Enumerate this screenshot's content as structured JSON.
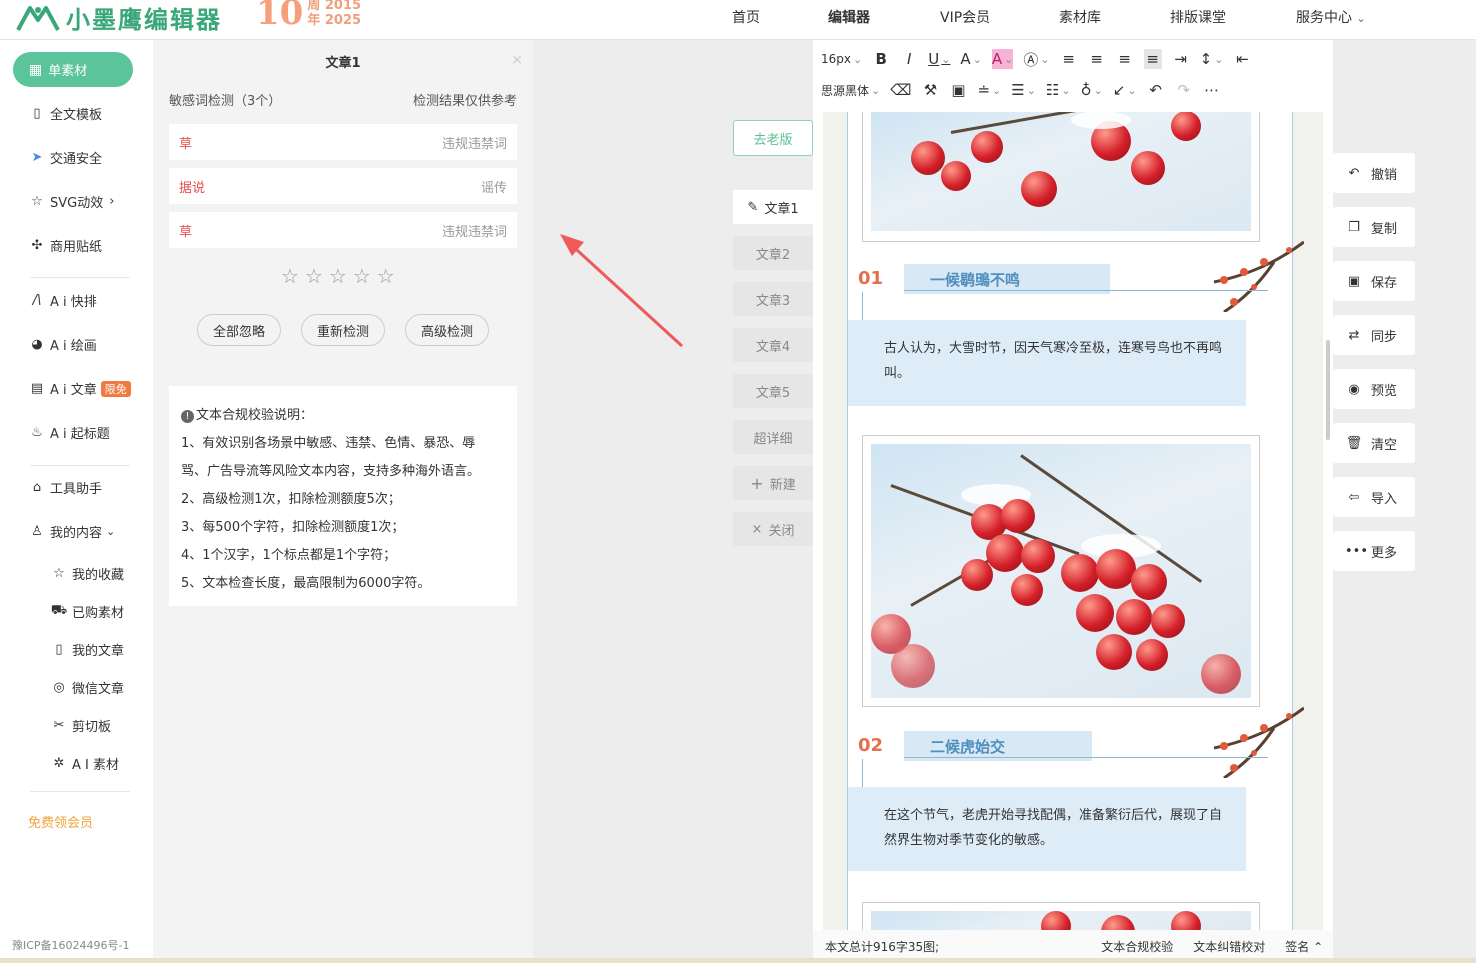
{
  "brand": {
    "name": "小墨鹰编辑器",
    "anniv_num": "10",
    "anniv_top": "周 2015",
    "anniv_bottom": "年 2025"
  },
  "nav": [
    "首页",
    "编辑器",
    "VIP会员",
    "素材库",
    "排版课堂",
    "服务中心"
  ],
  "sidebar": {
    "active": "单素材",
    "items": [
      {
        "label": "全文模板",
        "icon": "template-icon"
      },
      {
        "label": "交通安全",
        "icon": "traffic-icon"
      },
      {
        "label": "SVG动效",
        "icon": "star-icon",
        "arrow": "›"
      },
      {
        "label": "商用贴纸",
        "icon": "puzzle-icon"
      },
      {
        "label": "A i 快排",
        "icon": "ai-icon"
      },
      {
        "label": "A i 绘画",
        "icon": "palette-icon"
      },
      {
        "label": "A i 文章",
        "icon": "doc-icon",
        "badge": "限免"
      },
      {
        "label": "A i 起标题",
        "icon": "fire-icon"
      },
      {
        "label": "工具助手",
        "icon": "tool-icon"
      },
      {
        "label": "我的内容",
        "icon": "user-icon",
        "arrow": "⌄"
      }
    ],
    "sub": [
      {
        "label": "我的收藏",
        "icon": "star-icon"
      },
      {
        "label": "已购素材",
        "icon": "cart-icon"
      },
      {
        "label": "我的文章",
        "icon": "article-icon"
      },
      {
        "label": "微信文章",
        "icon": "wechat-icon"
      },
      {
        "label": "剪切板",
        "icon": "scissors-icon"
      },
      {
        "label": "A I 素材",
        "icon": "sparkle-icon"
      }
    ],
    "promo": "免费领会员",
    "icp": "豫ICP备16024496号-1"
  },
  "panel": {
    "title": "文章1",
    "close": "×",
    "detect_title": "敏感词检测（3个）",
    "detect_note": "检测结果仅供参考",
    "rows": [
      {
        "word": "草",
        "type": "违规违禁词"
      },
      {
        "word": "据说",
        "type": "谣传"
      },
      {
        "word": "草",
        "type": "违规违禁词"
      }
    ],
    "buttons": [
      "全部忽略",
      "重新检测",
      "高级检测"
    ],
    "note_title": "文本合规校验说明：",
    "note_lines": [
      "1、有效识别各场景中敏感、违禁、色情、暴恐、辱",
      "骂、广告导流等风险文本内容，支持多种海外语言。",
      "2、高级检测1次，扣除检测额度5次；",
      "3、每500个字符，扣除检测额度1次；",
      "4、1个汉字，1个标点都是1个字符；",
      "5、文本检查长度，最高限制为6000字符。"
    ]
  },
  "tabs": {
    "old": "去老版",
    "items": [
      "文章1",
      "文章2",
      "文章3",
      "文章4",
      "文章5",
      "超详细"
    ],
    "new": "新建",
    "close": "关闭"
  },
  "toolbar": {
    "font_size": "16px",
    "font_family": "思源黑体"
  },
  "content": {
    "sec1_num": "01",
    "sec1_title": "一候鹖鴠不鸣",
    "sec1_text": "古人认为，大雪时节，因天气寒冷至极，连寒号鸟也不再鸣叫。",
    "sec2_num": "02",
    "sec2_title": "二候虎始交",
    "sec2_text": "在这个节气，老虎开始寻找配偶，准备繁衍后代，展现了自然界生物对季节变化的敏感。"
  },
  "status": {
    "count": "本文总计916字35图;",
    "check": "文本合规校验",
    "correct": "文本纠错校对",
    "sign": "签名 ⌃"
  },
  "right": [
    "撤销",
    "复制",
    "保存",
    "同步",
    "预览",
    "清空",
    "导入",
    "更多"
  ]
}
